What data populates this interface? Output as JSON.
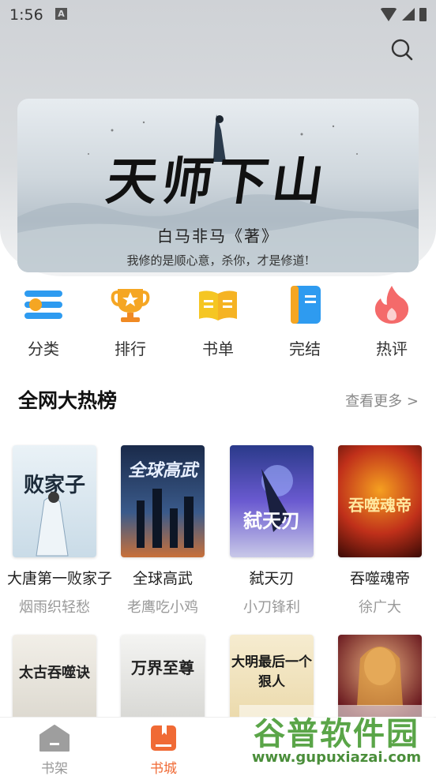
{
  "status_bar": {
    "time": "1:56",
    "notification_icon": "A"
  },
  "header": {
    "search_icon": "search-icon"
  },
  "banner": {
    "title": "天师下山",
    "author_line": "白马非马《著》",
    "tagline": "我修的是顺心意，杀你，才是修道!"
  },
  "categories": [
    {
      "label": "分类",
      "icon": "list-icon",
      "color": "#2e9bf0"
    },
    {
      "label": "排行",
      "icon": "trophy-icon",
      "color": "#f5a623"
    },
    {
      "label": "书单",
      "icon": "open-book-icon",
      "color": "#f5c623"
    },
    {
      "label": "完结",
      "icon": "book-icon",
      "color": "#2e9bf0"
    },
    {
      "label": "热评",
      "icon": "flame-icon",
      "color": "#f46a6a"
    }
  ],
  "hot_list": {
    "title": "全网大热榜",
    "more_label": "查看更多",
    "books": [
      {
        "title": "大唐第一败家子",
        "author": "烟雨织轻愁",
        "cover_text": "败家子"
      },
      {
        "title": "全球高武",
        "author": "老鹰吃小鸡",
        "cover_text": "全球高武"
      },
      {
        "title": "弑天刃",
        "author": "小刀锋利",
        "cover_text": "弑天刃"
      },
      {
        "title": "吞噬魂帝",
        "author": "徐广大",
        "cover_text": "吞噬魂帝"
      },
      {
        "title": "",
        "author": "",
        "cover_text": "太古吞噬诀"
      },
      {
        "title": "",
        "author": "",
        "cover_text": "万界至尊"
      },
      {
        "title": "",
        "author": "",
        "cover_text": "大明最后一个狠人"
      },
      {
        "title": "",
        "author": "",
        "cover_text": ""
      }
    ]
  },
  "tabbar": {
    "tabs": [
      {
        "label": "书架",
        "active": false
      },
      {
        "label": "书城",
        "active": true
      }
    ]
  },
  "watermark": {
    "top": "谷普软件园",
    "bottom": "www.gupuxiazai.com"
  },
  "colors": {
    "accent": "#f06a35",
    "inactive": "#999999"
  }
}
